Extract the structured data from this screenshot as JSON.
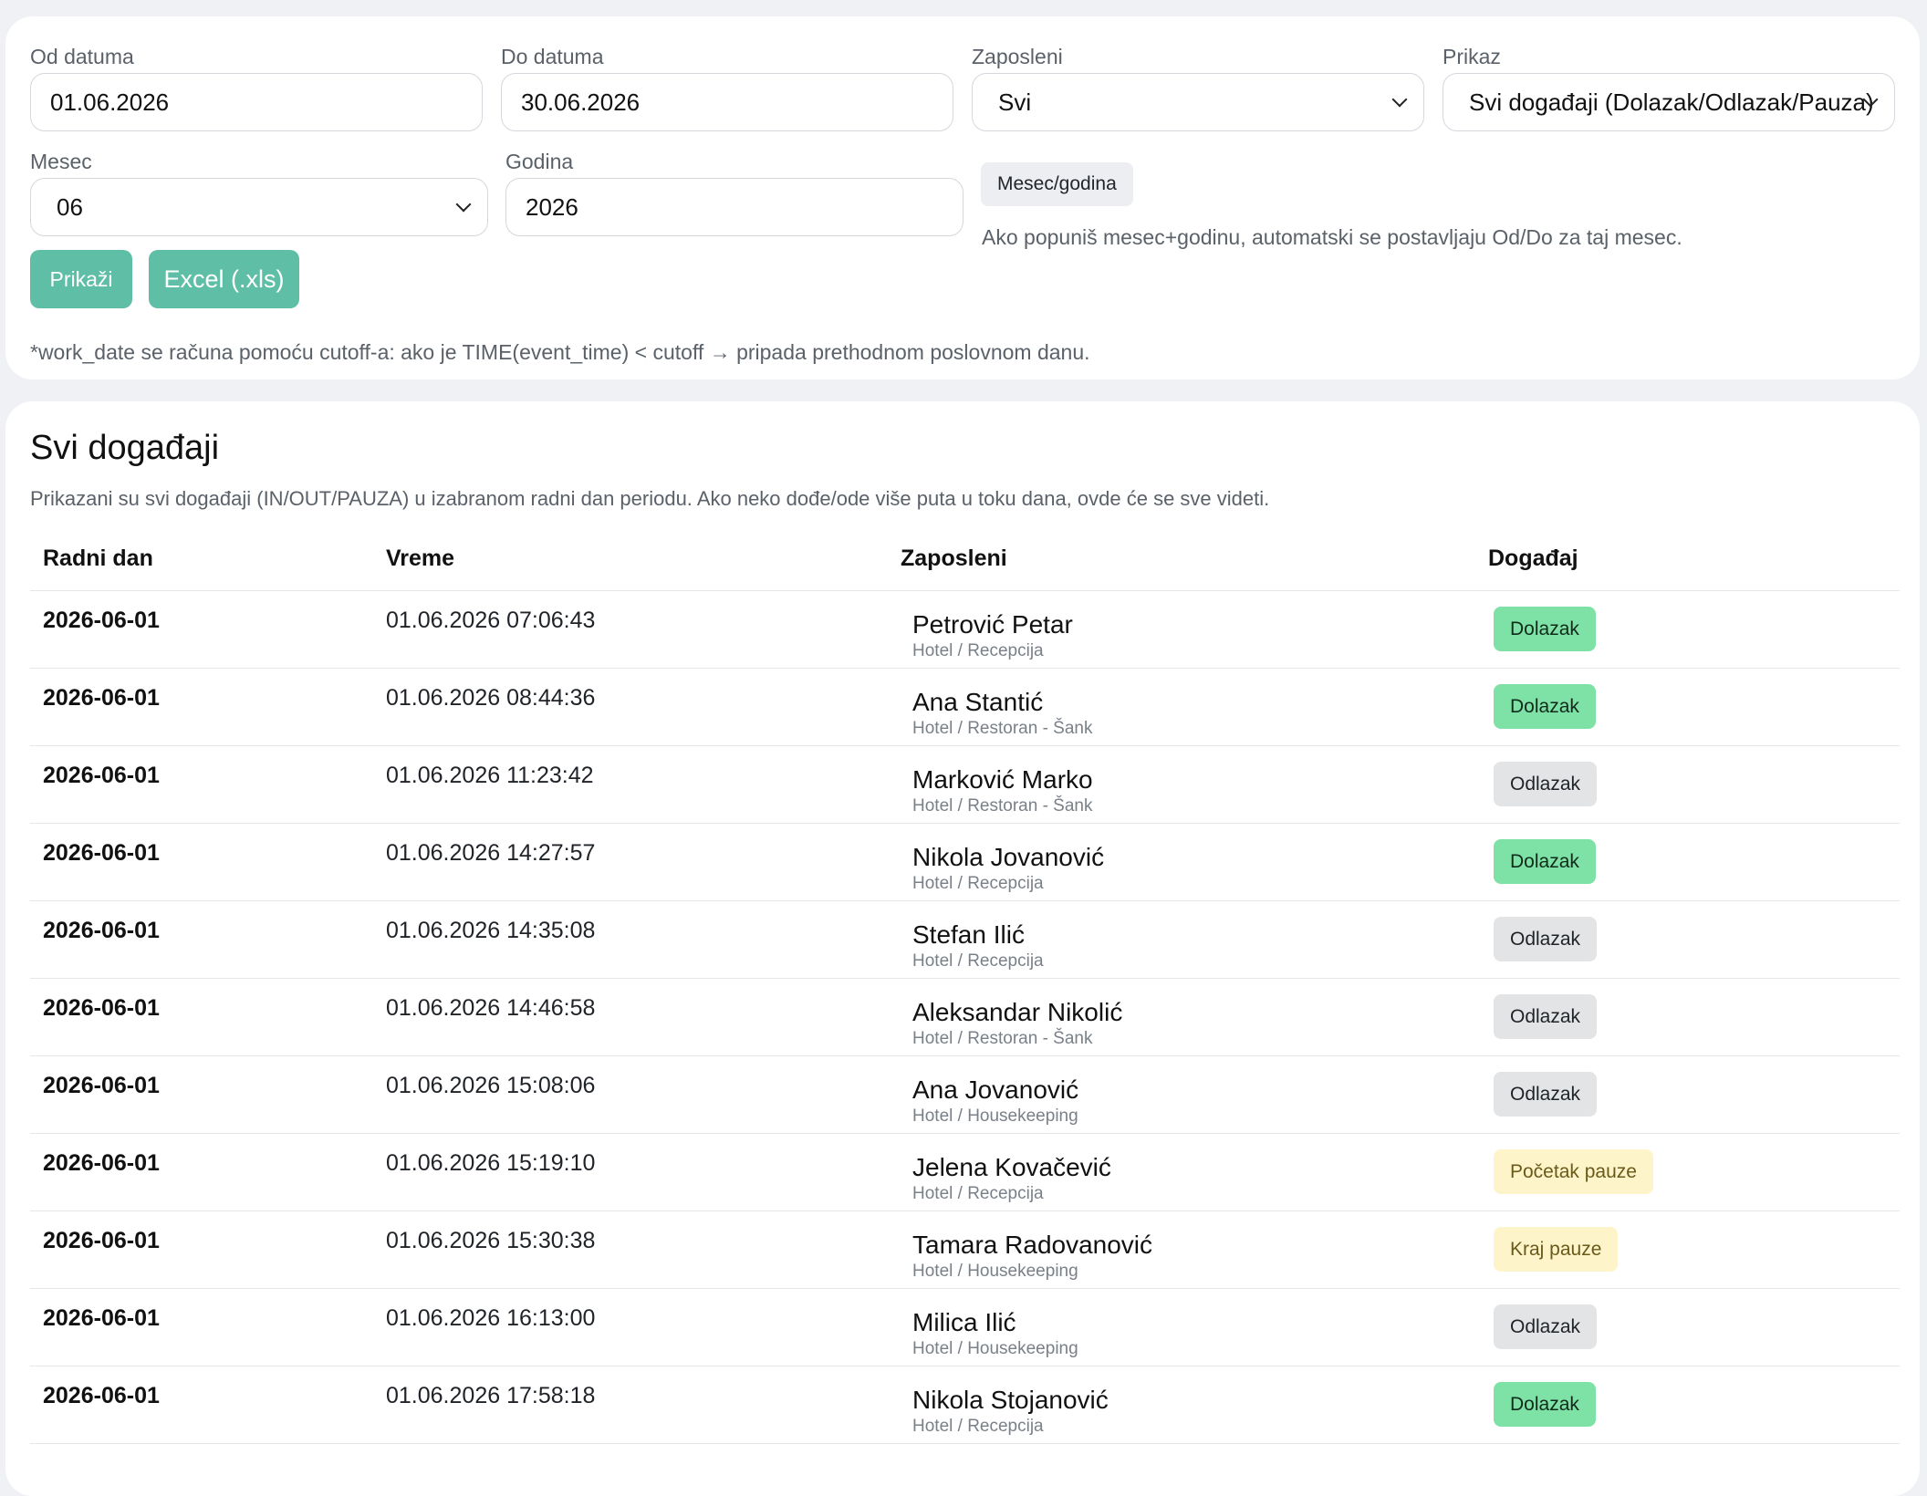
{
  "filters": {
    "od_datuma": {
      "label": "Od datuma",
      "value": "01.06.2026"
    },
    "do_datuma": {
      "label": "Do datuma",
      "value": "30.06.2026"
    },
    "zaposleni": {
      "label": "Zaposleni",
      "value": "Svi"
    },
    "prikaz": {
      "label": "Prikaz",
      "value": "Svi događaji (Dolazak/Odlazak/Pauza)"
    },
    "mesec": {
      "label": "Mesec",
      "value": "06"
    },
    "godina": {
      "label": "Godina",
      "value": "2026"
    },
    "mesec_godina_button": "Mesec/godina",
    "mesec_godina_hint": "Ako popuniš mesec+godinu, automatski se postavljaju Od/Do za taj mesec.",
    "prikazi_button": "Prikaži",
    "excel_button": "Excel (.xls)",
    "cutoff_note": "*work_date se računa pomoću cutoff-a: ako je TIME(event_time) < cutoff → pripada prethodnom poslovnom danu."
  },
  "events": {
    "title": "Svi događaji",
    "description": "Prikazani su svi događaji (IN/OUT/PAUZA) u izabranom radni dan periodu. Ako neko dođe/ode više puta u toku dana, ovde će se sve videti.",
    "columns": [
      "Radni dan",
      "Vreme",
      "Zaposleni",
      "Događaj"
    ],
    "rows": [
      {
        "day": "2026-06-01",
        "time": "01.06.2026 07:06:43",
        "name": "Petrović Petar",
        "dept": "Hotel / Recepcija",
        "event": "Dolazak",
        "kind": "in"
      },
      {
        "day": "2026-06-01",
        "time": "01.06.2026 08:44:36",
        "name": "Ana Stantić",
        "dept": "Hotel / Restoran - Šank",
        "event": "Dolazak",
        "kind": "in"
      },
      {
        "day": "2026-06-01",
        "time": "01.06.2026 11:23:42",
        "name": "Marković Marko",
        "dept": "Hotel / Restoran - Šank",
        "event": "Odlazak",
        "kind": "out"
      },
      {
        "day": "2026-06-01",
        "time": "01.06.2026 14:27:57",
        "name": "Nikola Jovanović",
        "dept": "Hotel / Recepcija",
        "event": "Dolazak",
        "kind": "in"
      },
      {
        "day": "2026-06-01",
        "time": "01.06.2026 14:35:08",
        "name": "Stefan Ilić",
        "dept": "Hotel / Recepcija",
        "event": "Odlazak",
        "kind": "out"
      },
      {
        "day": "2026-06-01",
        "time": "01.06.2026 14:46:58",
        "name": "Aleksandar Nikolić",
        "dept": "Hotel / Restoran - Šank",
        "event": "Odlazak",
        "kind": "out"
      },
      {
        "day": "2026-06-01",
        "time": "01.06.2026 15:08:06",
        "name": "Ana Jovanović",
        "dept": "Hotel / Housekeeping",
        "event": "Odlazak",
        "kind": "out"
      },
      {
        "day": "2026-06-01",
        "time": "01.06.2026 15:19:10",
        "name": "Jelena Kovačević",
        "dept": "Hotel / Recepcija",
        "event": "Početak pauze",
        "kind": "pause"
      },
      {
        "day": "2026-06-01",
        "time": "01.06.2026 15:30:38",
        "name": "Tamara Radovanović",
        "dept": "Hotel / Housekeeping",
        "event": "Kraj pauze",
        "kind": "pause"
      },
      {
        "day": "2026-06-01",
        "time": "01.06.2026 16:13:00",
        "name": "Milica Ilić",
        "dept": "Hotel / Housekeeping",
        "event": "Odlazak",
        "kind": "out"
      },
      {
        "day": "2026-06-01",
        "time": "01.06.2026 17:58:18",
        "name": "Nikola Stojanović",
        "dept": "Hotel / Recepcija",
        "event": "Dolazak",
        "kind": "in"
      }
    ]
  }
}
